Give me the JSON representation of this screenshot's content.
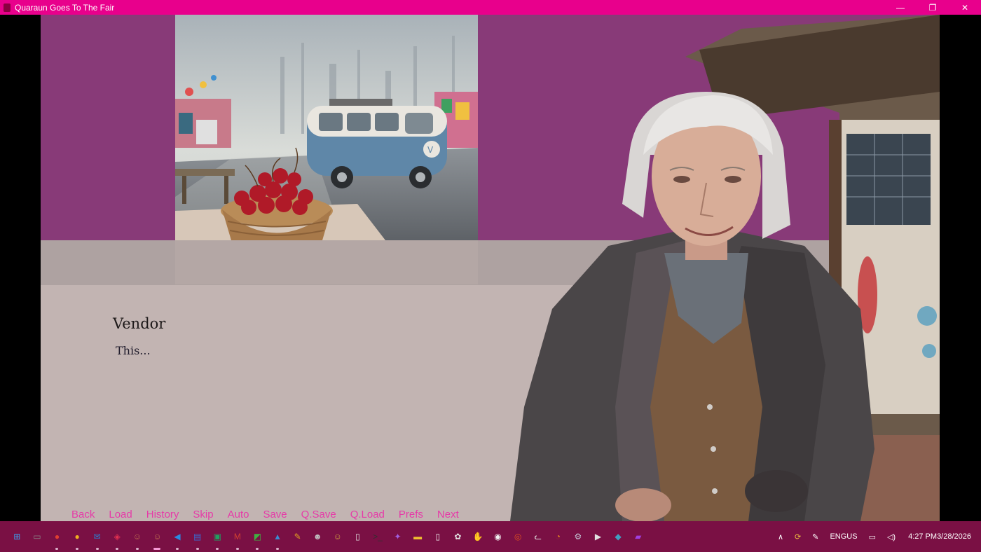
{
  "window": {
    "title": "Quaraun Goes To The Fair",
    "minimize": "—",
    "restore": "❐",
    "close": "✕"
  },
  "dialogue": {
    "speaker": "Vendor",
    "text": "This..."
  },
  "quick_menu": [
    "Back",
    "Load",
    "History",
    "Skip",
    "Auto",
    "Save",
    "Q.Save",
    "Q.Load",
    "Prefs",
    "Next"
  ],
  "taskbar": {
    "icons": [
      {
        "name": "windows-start-icon",
        "glyph": "⊞",
        "color": "#3aa0f0"
      },
      {
        "name": "task-view-icon",
        "glyph": "▭",
        "color": "#8a8a8a"
      },
      {
        "name": "chrome-icon",
        "glyph": "●",
        "color": "#e04030"
      },
      {
        "name": "chrome-alt-icon",
        "glyph": "●",
        "color": "#f0b020"
      },
      {
        "name": "mail-icon",
        "glyph": "✉",
        "color": "#2a80d0"
      },
      {
        "name": "pocket-icon",
        "glyph": "◈",
        "color": "#e03050"
      },
      {
        "name": "game-icon",
        "glyph": "☺",
        "color": "#c07050"
      },
      {
        "name": "game-active-icon",
        "glyph": "☺",
        "color": "#c07050"
      },
      {
        "name": "vscode-icon",
        "glyph": "◀",
        "color": "#2a8ae0"
      },
      {
        "name": "document-icon",
        "glyph": "▤",
        "color": "#3a6ad0"
      },
      {
        "name": "terminal-app-icon",
        "glyph": "▣",
        "color": "#20a060"
      },
      {
        "name": "gmail-icon",
        "glyph": "M",
        "color": "#d04030"
      },
      {
        "name": "notes-icon",
        "glyph": "◩",
        "color": "#40b040"
      },
      {
        "name": "photos-icon",
        "glyph": "▲",
        "color": "#3a8ad0"
      },
      {
        "name": "pencil-icon",
        "glyph": "✎",
        "color": "#e0a020"
      },
      {
        "name": "ghost-icon",
        "glyph": "☻",
        "color": "#c0c0c0"
      },
      {
        "name": "avatar-icon",
        "glyph": "☺",
        "color": "#d0a040"
      },
      {
        "name": "clipboard-icon",
        "glyph": "▯",
        "color": "#e0e0e0"
      },
      {
        "name": "console-icon",
        "glyph": ">_",
        "color": "#303030"
      },
      {
        "name": "copilot-icon",
        "glyph": "✦",
        "color": "#a060e0"
      },
      {
        "name": "folder-icon",
        "glyph": "▬",
        "color": "#f0c030"
      },
      {
        "name": "file-icon",
        "glyph": "▯",
        "color": "#f0f0f0"
      },
      {
        "name": "chatgpt-icon",
        "glyph": "✿",
        "color": "#e0e0e0"
      },
      {
        "name": "hand-icon",
        "glyph": "✋",
        "color": "#f0c040"
      },
      {
        "name": "camera-icon",
        "glyph": "◉",
        "color": "#f0f0f0"
      },
      {
        "name": "ubuntu-icon",
        "glyph": "◎",
        "color": "#e05020"
      },
      {
        "name": "cat-icon",
        "glyph": "ᓚ",
        "color": "#e0e0e0"
      },
      {
        "name": "blender-icon",
        "glyph": "◔",
        "color": "#e08020"
      },
      {
        "name": "settings-icon",
        "glyph": "⚙",
        "color": "#c0c0d0"
      },
      {
        "name": "media-player-icon",
        "glyph": "▶",
        "color": "#e0e0e0"
      },
      {
        "name": "map-app-icon",
        "glyph": "◆",
        "color": "#40a0c0"
      },
      {
        "name": "film-icon",
        "glyph": "▰",
        "color": "#a040e0"
      }
    ],
    "tray": {
      "chevron": "∧",
      "lang_top": "ENG",
      "lang_bottom": "US",
      "time": "4:27 PM",
      "date": "3/28/2026"
    }
  }
}
